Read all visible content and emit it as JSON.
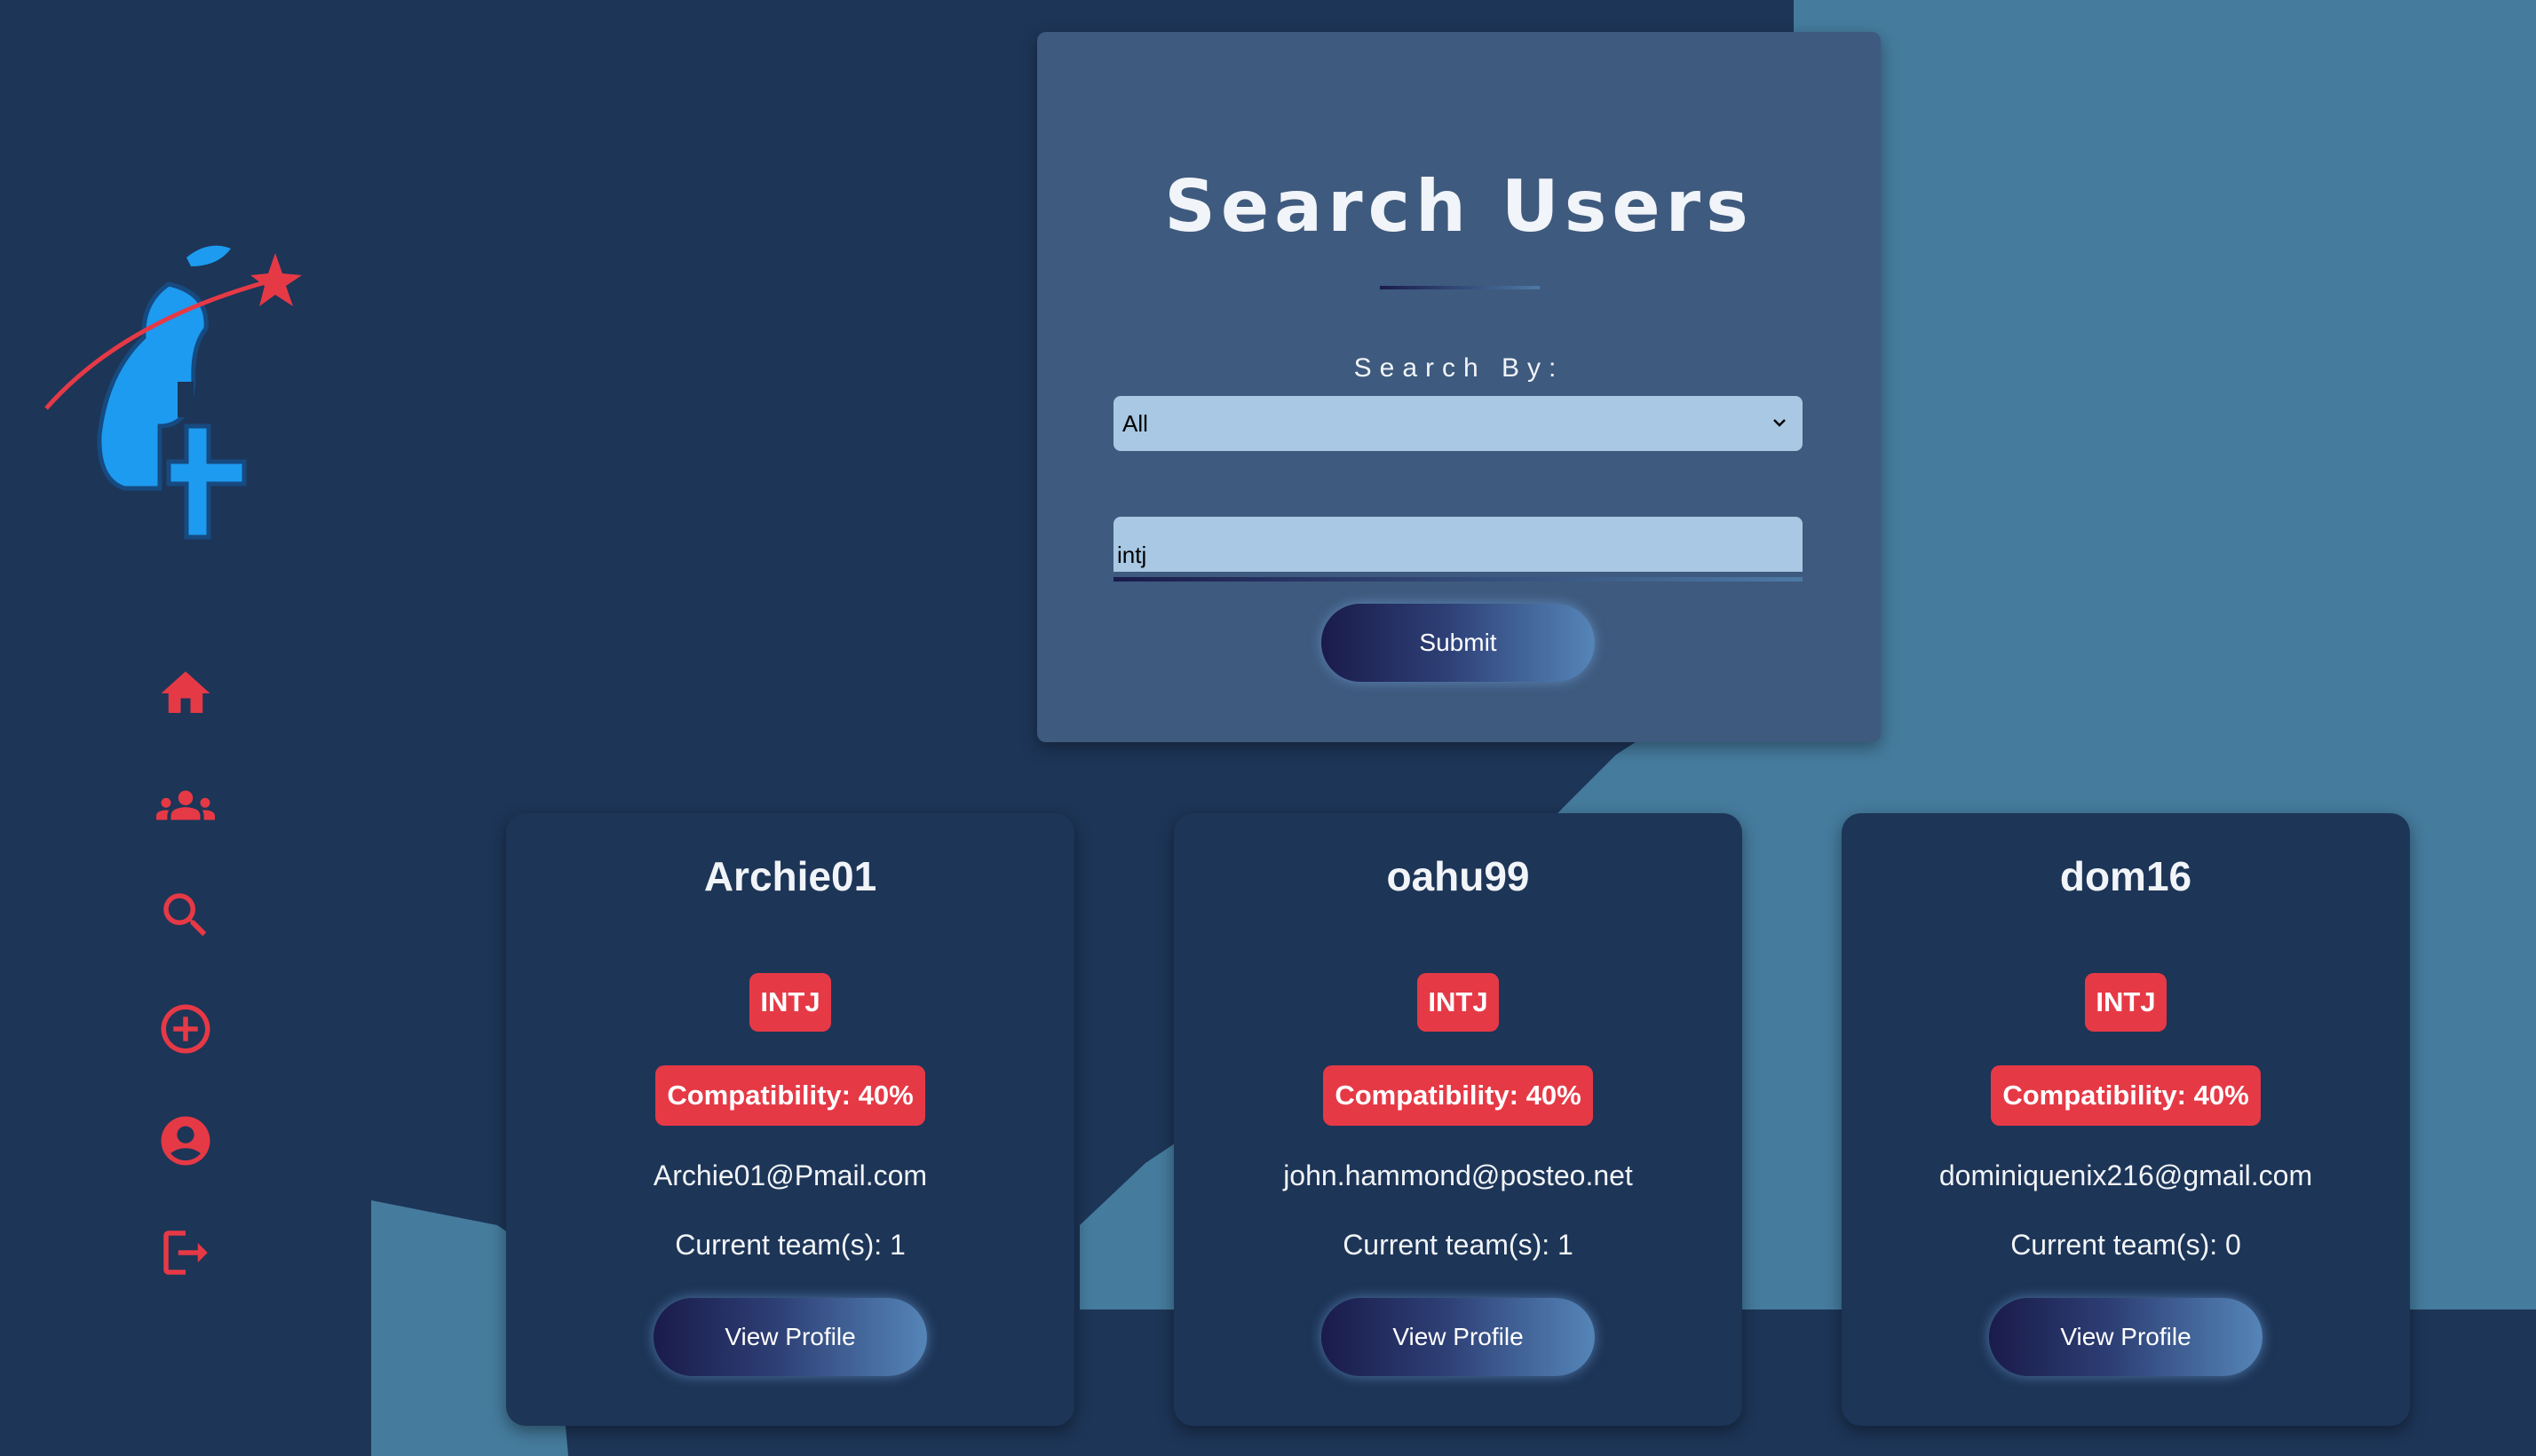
{
  "colors": {
    "background_dark": "#1d3557",
    "background_light": "#457b9d",
    "panel": "#3e5a7e",
    "accent_red": "#e63946",
    "input_bg": "#a8c8e3",
    "logo_blue": "#1d9bf0"
  },
  "sidebar": {
    "logo_icon": "pear-plus-logo",
    "items": [
      {
        "icon": "home-icon"
      },
      {
        "icon": "group-icon"
      },
      {
        "icon": "search-icon"
      },
      {
        "icon": "add-circle-icon"
      },
      {
        "icon": "account-circle-icon"
      },
      {
        "icon": "logout-icon"
      }
    ]
  },
  "search": {
    "title": "Search Users",
    "search_by_label": "Search By:",
    "select_value": "All",
    "query_value": "intj",
    "submit_label": "Submit"
  },
  "results": [
    {
      "username": "Archie01",
      "type": "INTJ",
      "compatibility": "Compatibility: 40%",
      "email": "Archie01@Pmail.com",
      "teams": "Current team(s): 1",
      "button_label": "View Profile"
    },
    {
      "username": "oahu99",
      "type": "INTJ",
      "compatibility": "Compatibility: 40%",
      "email": "john.hammond@posteo.net",
      "teams": "Current team(s): 1",
      "button_label": "View Profile"
    },
    {
      "username": "dom16",
      "type": "INTJ",
      "compatibility": "Compatibility: 40%",
      "email": "dominiquenix216@gmail.com",
      "teams": "Current team(s): 0",
      "button_label": "View Profile"
    }
  ]
}
